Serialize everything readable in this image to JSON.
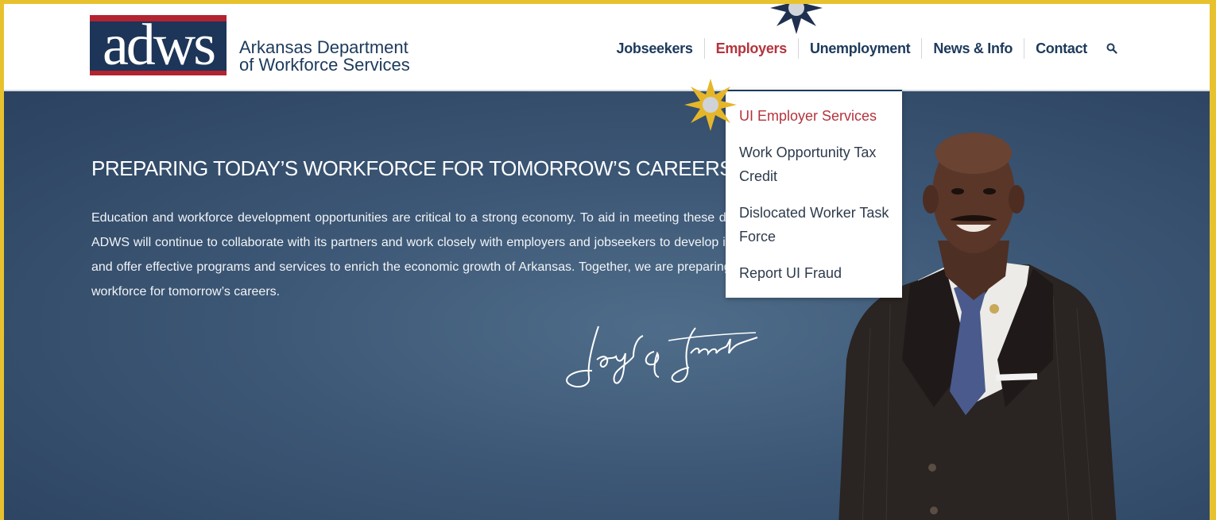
{
  "logo": {
    "letters": "adws",
    "line1": "Arkansas Department",
    "line2": "of Workforce Services"
  },
  "nav": {
    "items": [
      {
        "label": "Jobseekers"
      },
      {
        "label": "Employers",
        "active": true
      },
      {
        "label": "Unemployment"
      },
      {
        "label": "News & Info"
      },
      {
        "label": "Contact"
      }
    ],
    "search_icon": "search-icon"
  },
  "dropdown": {
    "items": [
      {
        "label": "UI Employer Services",
        "active": true
      },
      {
        "label": "Work Opportunity Tax Credit"
      },
      {
        "label": "Dislocated Worker Task Force"
      },
      {
        "label": "Report UI Fraud"
      }
    ]
  },
  "hero": {
    "title": "PREPARING TODAY’S WORKFORCE FOR TOMORROW’S CAREERS",
    "body": "Education and workforce development opportunities are critical to a strong economy. To aid in meeting these demands, ADWS will continue to collaborate with its partners and work closely with employers and jobseekers to develop initiatives and offer effective programs and services to enrich the economic growth of Arkansas. Together, we are preparing today’s workforce for tomorrow’s careers.",
    "signature": "Daryl E. Bassett"
  },
  "colors": {
    "frame": "#e8c22e",
    "navy": "#1d3a5c",
    "accent_red": "#b4343d",
    "hero_bg": "#3c5775"
  }
}
